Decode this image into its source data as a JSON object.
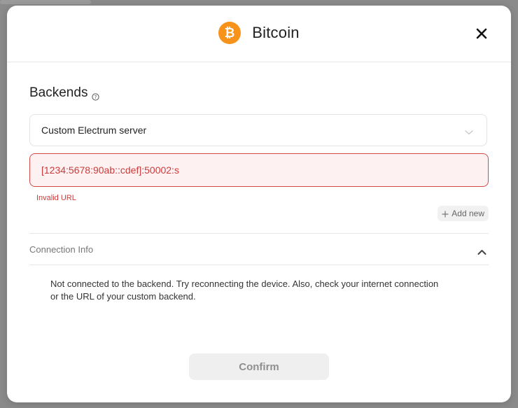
{
  "header": {
    "title": "Bitcoin",
    "coin_icon": "bitcoin-icon",
    "coin_color": "#f7931a",
    "close_icon": "close-icon"
  },
  "backends": {
    "section_title": "Backends",
    "help_icon": "help-icon",
    "selected_backend": "Custom Electrum server",
    "url_value": "[1234:5678:90ab::cdef]:50002:s",
    "error_message": "Invalid URL",
    "error_color": "#cc3b3b",
    "add_new_label": "Add new"
  },
  "connection_info": {
    "title": "Connection Info",
    "expanded": true,
    "message": "Not connected to the backend. Try reconnecting the device. Also, check your internet connection or the URL of your custom backend."
  },
  "footer": {
    "confirm_label": "Confirm"
  }
}
